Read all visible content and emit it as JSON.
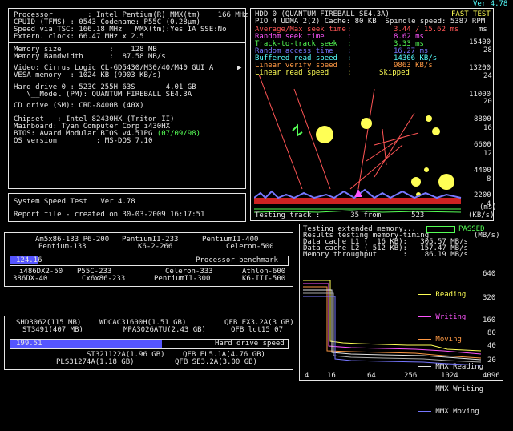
{
  "version": "Ver 4.78",
  "sysinfo": {
    "processor": "Processor        : Intel Pentium(R) MMX(tm)    166 MHz",
    "cpuid": "CPUID (TFMS) : 0543 Codename: P55C (0.28µm)",
    "speed_tsc": "Speed via TSC: 166.18 MHz   MMX(tm):Yes IA SSE:No",
    "extern_clock": "Extern. clock: 66.47 MHz x 2.5",
    "memory_size": "Memory size           :    128 MB",
    "memory_bandwidth": "Memory Bandwidth      :  87.58 MB/s",
    "video": "Video: Cirrus Logic CL-GD5430/M30/40/M40 GUI A",
    "vesa": "VESA memory  : 1024 KB (9903 KB/s)",
    "hdd0": "Hard drive 0 : 523C 255H 63S       4.01 GB",
    "hdd0_model": "   \\__Model (PM): QUANTUM FIREBALL SE4.3A",
    "cd_drive": "CD drive (SM): CRD-8400B (40X)",
    "chipset": "Chipset   : Intel 82430HX (Triton II)",
    "mainboard": "Mainboard: Tyan Computer Corp i430HX",
    "bios": "BIOS: Award Modular BIOS v4.51PG ",
    "bios_date": "(07/09/98)",
    "os": "OS version         : MS-DOS 7.10"
  },
  "speed_test": {
    "title": "System Speed Test   Ver 4.78",
    "report": "Report file - created on 30-03-2009 16:17:51"
  },
  "hdd": {
    "header_a": "HDD 0 (QUANTUM FIREBALL SE4.3A)",
    "fast_test": "FAST TEST",
    "header_b": "PIO 4 UDMA 2(2) Cache: 80 KB  Spindle speed: 5387 RPM",
    "ms_unit": "ms",
    "labels": {
      "avg_seek": "Average/Max seek time",
      "random_seek": "Random seek time",
      "track_to_track": "Track-to-track seek",
      "random_access": "Random access time",
      "buffered_read": "Buffered read speed",
      "linear_verify": "Linear verify speed",
      "linear_read": "Linear read speed"
    },
    "values": {
      "avg_seek": "3.44 / 15.62 ms",
      "random_seek": "8.62 ms",
      "track_to_track": "3.33 ms",
      "random_access": "16.27 ms",
      "buffered_read": "14306 KB/s",
      "linear_verify": "9863 KB/s",
      "linear_read": "Skipped"
    },
    "right_scale": [
      "15400",
      "13200",
      "11000",
      "8800",
      "6600",
      "4400",
      "2200"
    ],
    "left_scale": [
      "28",
      "24",
      "20",
      "16",
      "12",
      "8",
      "4"
    ],
    "bottom_unit_ms": "(ms)",
    "testing_track": "Testing track :       35 from       523",
    "kbs": "(KB/s)"
  },
  "memtest": {
    "line1": "Testing extended memory...",
    "passed": "PASSED",
    "line2": "Results testing memory-timing",
    "unit": "(MB/s)",
    "l1": "Data cache L1 (  16 KB):   305.57 MB/s",
    "l2": "Data cache L2 ( 512 KB):   157.47 MB/s",
    "throughput": "Memory throughput      :    86.19 MB/s",
    "y_labels": [
      "640",
      "320",
      "160",
      "80",
      "40",
      "20"
    ],
    "x_labels": [
      "4",
      "16",
      "64",
      "256",
      "1024",
      "4096"
    ],
    "legend": [
      {
        "name": "Reading",
        "color": "#ffff55"
      },
      {
        "name": "Writing",
        "color": "#ff55ff"
      },
      {
        "name": "Moving",
        "color": "#ff9944"
      },
      {
        "name": "MMX Reading",
        "color": "#e6e6e6"
      },
      {
        "name": "MMX Writing",
        "color": "#aaaaaa"
      },
      {
        "name": "MMX Moving",
        "color": "#7777ff"
      }
    ]
  },
  "cpu_bench": {
    "top_labels": [
      "Am5x86-133 P6-200",
      "PentiumII-233",
      "PentiumII-400"
    ],
    "top_labels2": [
      "Pentium-133",
      "K6-2-266",
      "Celeron-500"
    ],
    "value": "124.16",
    "title": "Processor benchmark",
    "bottom_labels": [
      "i486DX2-50",
      "P55C-233",
      "Celeron-333",
      "Athlon-600"
    ],
    "bottom_labels2": [
      "386DX-40",
      "Cx6x86-233",
      "PentiumII-300",
      "K6-III-500"
    ],
    "fraction": 0.1
  },
  "hd_bench": {
    "top_labels": [
      "SHD3062(115 MB)",
      "WDCAC31600H(1.51 GB)",
      "QFB EX3.2A(3 GB)"
    ],
    "top_labels2": [
      "ST3491(407 MB)",
      "MPA3026ATU(2.43 GB)",
      "QFB lct15 07"
    ],
    "value": "199.51",
    "title": "Hard drive speed",
    "bottom_labels": [
      "ST321122A(1.96 GB)",
      "QFB EL5.1A(4.76 GB)"
    ],
    "bottom_labels2": [
      "PLS31274A(1.18 GB)",
      "QFB SE3.2A(3.00 GB)"
    ],
    "fraction": 0.55
  },
  "colors": {
    "bar_blue": "#5555ff",
    "border": "#e6e6e6"
  }
}
